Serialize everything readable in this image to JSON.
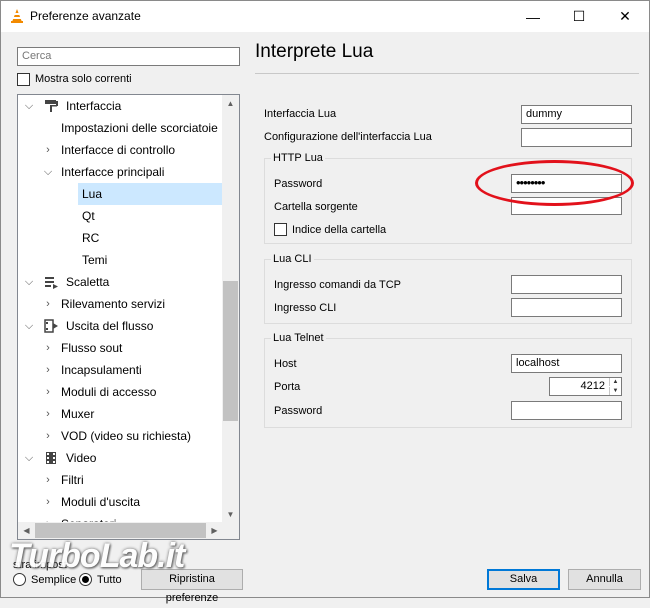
{
  "window": {
    "title": "Preferenze avanzate",
    "controls": {
      "minimize": "—",
      "maximize": "☐",
      "close": "✕"
    }
  },
  "search": {
    "placeholder": "Cerca"
  },
  "filter": {
    "show_current_label": "Mostra solo correnti",
    "checked": false
  },
  "tree": {
    "items": [
      {
        "label": "Interfaccia",
        "level": 0,
        "expander": "expanded",
        "icon": "paint-roller-icon"
      },
      {
        "label": "Impostazioni delle scorciatoie",
        "level": 1,
        "expander": "none"
      },
      {
        "label": "Interfacce di controllo",
        "level": 1,
        "expander": "collapsed"
      },
      {
        "label": "Interfacce principali",
        "level": 1,
        "expander": "expanded"
      },
      {
        "label": "Lua",
        "level": 2,
        "expander": "none",
        "selected": true
      },
      {
        "label": "Qt",
        "level": 2,
        "expander": "none"
      },
      {
        "label": "RC",
        "level": 2,
        "expander": "none"
      },
      {
        "label": "Temi",
        "level": 2,
        "expander": "none"
      },
      {
        "label": "Scaletta",
        "level": 0,
        "expander": "expanded",
        "icon": "playlist-icon"
      },
      {
        "label": "Rilevamento servizi",
        "level": 1,
        "expander": "collapsed"
      },
      {
        "label": "Uscita del flusso",
        "level": 0,
        "expander": "expanded",
        "icon": "stream-output-icon"
      },
      {
        "label": "Flusso sout",
        "level": 1,
        "expander": "collapsed"
      },
      {
        "label": "Incapsulamenti",
        "level": 1,
        "expander": "collapsed"
      },
      {
        "label": "Moduli di accesso",
        "level": 1,
        "expander": "collapsed"
      },
      {
        "label": "Muxer",
        "level": 1,
        "expander": "collapsed"
      },
      {
        "label": "VOD (video su richiesta)",
        "level": 1,
        "expander": "collapsed"
      },
      {
        "label": "Video",
        "level": 0,
        "expander": "expanded",
        "icon": "video-film-icon"
      },
      {
        "label": "Filtri",
        "level": 1,
        "expander": "collapsed"
      },
      {
        "label": "Moduli d'uscita",
        "level": 1,
        "expander": "collapsed"
      },
      {
        "label": "Separatori",
        "level": 1,
        "expander": "collapsed"
      }
    ]
  },
  "panel": {
    "title": "Interprete Lua",
    "lua_interface": {
      "label": "Interfaccia Lua",
      "value": "dummy"
    },
    "lua_config": {
      "label": "Configurazione dell'interfaccia Lua",
      "value": ""
    },
    "http": {
      "title": "HTTP Lua",
      "password": {
        "label": "Password",
        "value": "••••••••"
      },
      "source_dir": {
        "label": "Cartella sorgente",
        "value": ""
      },
      "index": {
        "label": "Indice della cartella",
        "checked": false
      }
    },
    "cli": {
      "title": "Lua CLI",
      "tcp": {
        "label": "Ingresso comandi da TCP",
        "value": ""
      },
      "cli_input": {
        "label": "Ingresso CLI",
        "value": ""
      }
    },
    "telnet": {
      "title": "Lua Telnet",
      "host": {
        "label": "Host",
        "value": "localhost"
      },
      "port": {
        "label": "Porta",
        "value": "4212"
      },
      "password": {
        "label": "Password",
        "value": ""
      }
    }
  },
  "footer": {
    "view_label": "stra impost",
    "simple": "Semplice",
    "all": "Tutto",
    "reset": "Ripristina preferenze",
    "save": "Salva",
    "cancel": "Annulla"
  },
  "watermark": "TurboLab.it",
  "annotation_color": "#e2111b"
}
